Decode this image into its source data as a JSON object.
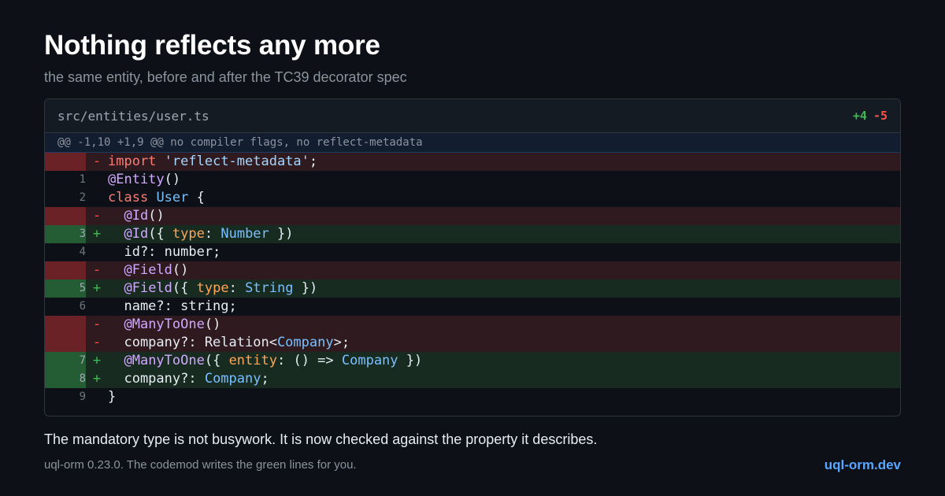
{
  "heading": {
    "title": "Nothing reflects any more",
    "subtitle": "the same entity, before and after the TC39 decorator spec"
  },
  "diff": {
    "filename": "src/entities/user.ts",
    "additions": "+4",
    "deletions": "-5",
    "hunk_header": "@@ -1,10 +1,9 @@ no compiler flags, no reflect-metadata",
    "lines": [
      {
        "kind": "del",
        "num": "",
        "marker": "-",
        "code": [
          {
            "t": "import",
            "c": "kw"
          },
          {
            "t": " "
          },
          {
            "t": "'reflect-metadata'",
            "c": "str"
          },
          {
            "t": ";"
          }
        ]
      },
      {
        "kind": "ctx",
        "num": "1",
        "marker": "",
        "code": [
          {
            "t": "@Entity",
            "c": "dec"
          },
          {
            "t": "()"
          }
        ]
      },
      {
        "kind": "ctx",
        "num": "2",
        "marker": "",
        "code": [
          {
            "t": "class",
            "c": "kw"
          },
          {
            "t": " "
          },
          {
            "t": "User",
            "c": "type"
          },
          {
            "t": " {"
          }
        ]
      },
      {
        "kind": "del",
        "num": "",
        "marker": "-",
        "code": [
          {
            "t": "  "
          },
          {
            "t": "@Id",
            "c": "dec"
          },
          {
            "t": "()"
          }
        ]
      },
      {
        "kind": "add",
        "num": "3",
        "marker": "+",
        "code": [
          {
            "t": "  "
          },
          {
            "t": "@Id",
            "c": "dec"
          },
          {
            "t": "({ "
          },
          {
            "t": "type",
            "c": "prop"
          },
          {
            "t": ": "
          },
          {
            "t": "Number",
            "c": "type"
          },
          {
            "t": " })"
          }
        ]
      },
      {
        "kind": "ctx",
        "num": "4",
        "marker": "",
        "code": [
          {
            "t": "  id?: number;"
          }
        ]
      },
      {
        "kind": "del",
        "num": "",
        "marker": "-",
        "code": [
          {
            "t": "  "
          },
          {
            "t": "@Field",
            "c": "dec"
          },
          {
            "t": "()"
          }
        ]
      },
      {
        "kind": "add",
        "num": "5",
        "marker": "+",
        "code": [
          {
            "t": "  "
          },
          {
            "t": "@Field",
            "c": "dec"
          },
          {
            "t": "({ "
          },
          {
            "t": "type",
            "c": "prop"
          },
          {
            "t": ": "
          },
          {
            "t": "String",
            "c": "type"
          },
          {
            "t": " })"
          }
        ]
      },
      {
        "kind": "ctx",
        "num": "6",
        "marker": "",
        "code": [
          {
            "t": "  name?: string;"
          }
        ]
      },
      {
        "kind": "del",
        "num": "",
        "marker": "-",
        "code": [
          {
            "t": "  "
          },
          {
            "t": "@ManyToOne",
            "c": "dec"
          },
          {
            "t": "()"
          }
        ]
      },
      {
        "kind": "del",
        "num": "",
        "marker": "-",
        "code": [
          {
            "t": "  company?: Relation<"
          },
          {
            "t": "Company",
            "c": "type"
          },
          {
            "t": ">;"
          }
        ]
      },
      {
        "kind": "add",
        "num": "7",
        "marker": "+",
        "code": [
          {
            "t": "  "
          },
          {
            "t": "@ManyToOne",
            "c": "dec"
          },
          {
            "t": "({ "
          },
          {
            "t": "entity",
            "c": "prop"
          },
          {
            "t": ": () => "
          },
          {
            "t": "Company",
            "c": "type"
          },
          {
            "t": " })"
          }
        ]
      },
      {
        "kind": "add",
        "num": "8",
        "marker": "+",
        "code": [
          {
            "t": "  company?: "
          },
          {
            "t": "Company",
            "c": "type"
          },
          {
            "t": ";"
          }
        ]
      },
      {
        "kind": "ctx",
        "num": "9",
        "marker": "",
        "code": [
          {
            "t": "}"
          }
        ]
      }
    ]
  },
  "caption": "The mandatory type is not busywork. It is now checked against the property it describes.",
  "footer": {
    "note": "uql-orm 0.23.0. The codemod writes the green lines for you.",
    "site": "uql-orm.dev"
  },
  "colors": {
    "background": "#0d1117",
    "addition": "#3fb950",
    "deletion": "#f85149",
    "link": "#58a6ff"
  }
}
